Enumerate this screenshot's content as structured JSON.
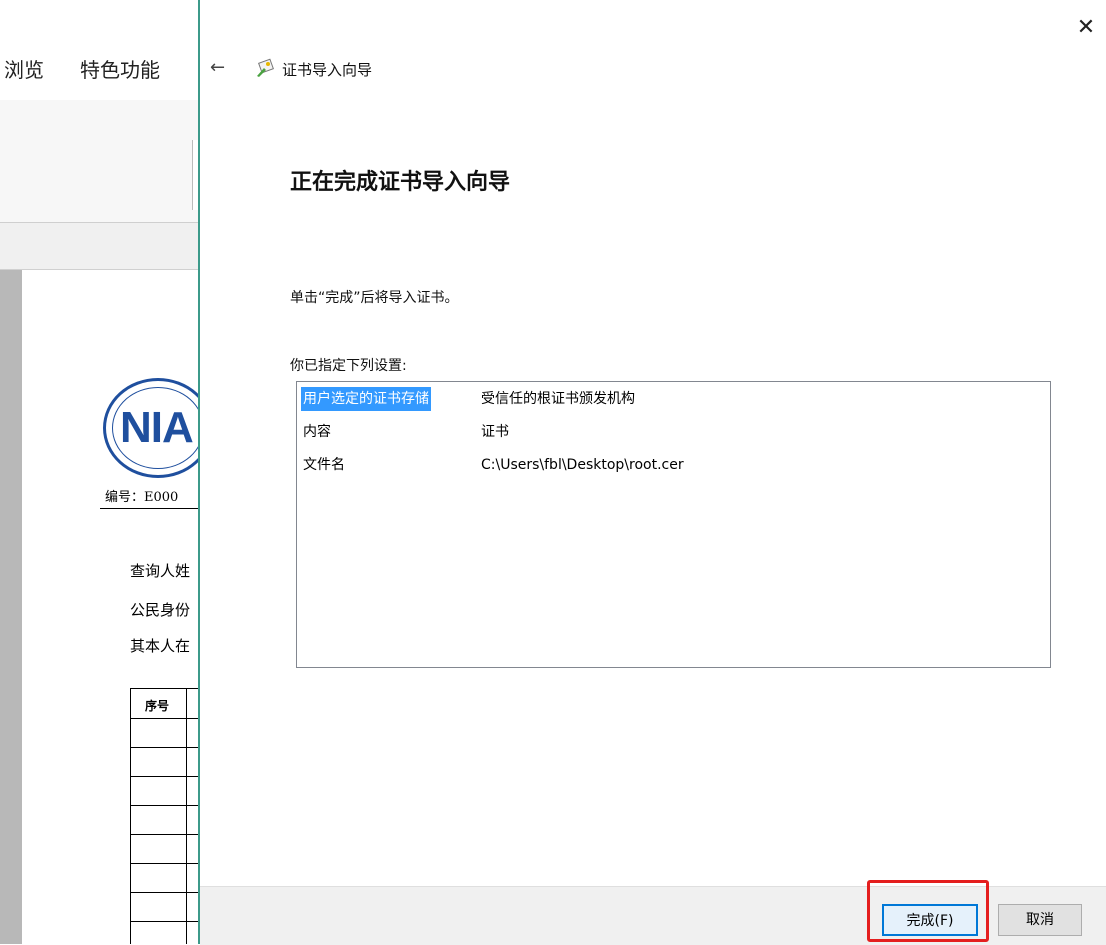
{
  "background_app": {
    "menu": [
      "浏览",
      "特色功能"
    ],
    "document": {
      "seal_text": "NIA",
      "number_label": "编号：E000",
      "lines": [
        "查询人姓",
        "公民身份",
        "其本人在"
      ],
      "table_header": "序号"
    }
  },
  "dialog": {
    "wizard_title": "证书导入向导",
    "heading": "正在完成证书导入向导",
    "instruction": "单击“完成”后将导入证书。",
    "settings_label": "你已指定下列设置:",
    "settings": [
      {
        "key": "用户选定的证书存储",
        "value": "受信任的根证书颁发机构"
      },
      {
        "key": "内容",
        "value": "证书"
      },
      {
        "key": "文件名",
        "value": "C:\\Users\\fbl\\Desktop\\root.cer"
      }
    ],
    "buttons": {
      "finish": "完成(F)",
      "cancel": "取消"
    },
    "icons": {
      "close": "close-icon",
      "back": "back-arrow-icon",
      "wizard": "certificate-icon"
    }
  },
  "colors": {
    "selection": "#3399ff",
    "highlight": "#e41e1e",
    "primary_button_border": "#0078d7",
    "dialog_border": "#3c9a8a"
  }
}
